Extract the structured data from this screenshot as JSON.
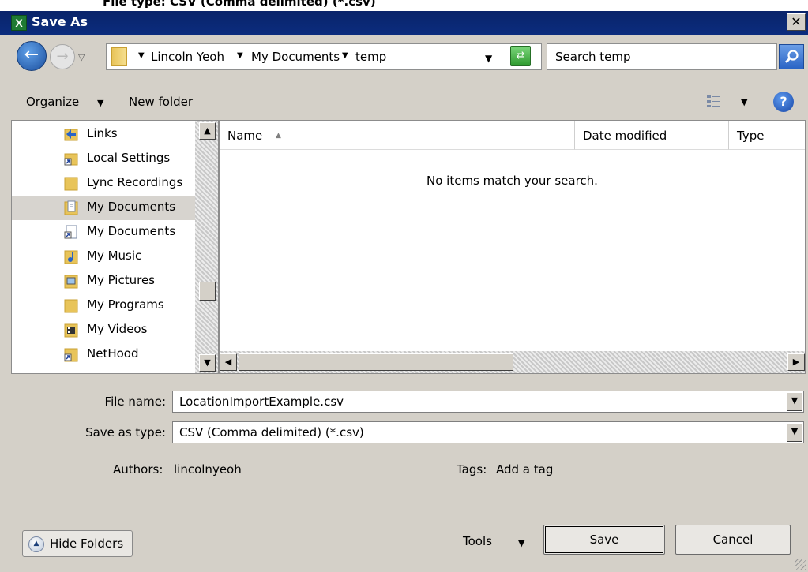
{
  "window": {
    "title": "Save As",
    "background_strip_text": "File type: CSV (Comma delimited) (*.csv)",
    "close_glyph": "✕",
    "app_icon_glyph": "X",
    "app_icon": "excel-icon"
  },
  "address_bar": {
    "crumbs": [
      "Lincoln Yeoh",
      "My Documents",
      "temp"
    ],
    "search_placeholder": "Search temp"
  },
  "toolbar": {
    "organize_label": "Organize",
    "new_folder_label": "New folder",
    "help_glyph": "?"
  },
  "nav_pane": {
    "items": [
      {
        "label": "Links",
        "icon": "links-folder-icon",
        "selected": false
      },
      {
        "label": "Local Settings",
        "icon": "shortcut-icon",
        "selected": false
      },
      {
        "label": "Lync Recordings",
        "icon": "folder-icon",
        "selected": false
      },
      {
        "label": "My Documents",
        "icon": "documents-folder-icon",
        "selected": true
      },
      {
        "label": "My Documents",
        "icon": "documents-shortcut-icon",
        "selected": false
      },
      {
        "label": "My Music",
        "icon": "music-folder-icon",
        "selected": false
      },
      {
        "label": "My Pictures",
        "icon": "pictures-folder-icon",
        "selected": false
      },
      {
        "label": "My Programs",
        "icon": "folder-icon",
        "selected": false
      },
      {
        "label": "My Videos",
        "icon": "videos-folder-icon",
        "selected": false
      },
      {
        "label": "NetHood",
        "icon": "shortcut-icon",
        "selected": false
      }
    ]
  },
  "file_list": {
    "columns": [
      "Name",
      "Date modified",
      "Type"
    ],
    "sorted_column": "Name",
    "empty_message": "No items match your search."
  },
  "form": {
    "file_name_label": "File name:",
    "file_name_value": "LocationImportExample.csv",
    "save_as_type_label": "Save as type:",
    "save_as_type_value": "CSV (Comma delimited) (*.csv)",
    "authors_label": "Authors:",
    "authors_value": "lincolnyeoh",
    "tags_label": "Tags:",
    "tags_value": "Add a tag"
  },
  "buttons": {
    "hide_folders": "Hide Folders",
    "tools": "Tools",
    "save": "Save",
    "cancel": "Cancel"
  },
  "colors": {
    "titlebar": "#0a246a",
    "dialog_bg": "#d4d0c8",
    "selection": "#d7d4cf"
  }
}
